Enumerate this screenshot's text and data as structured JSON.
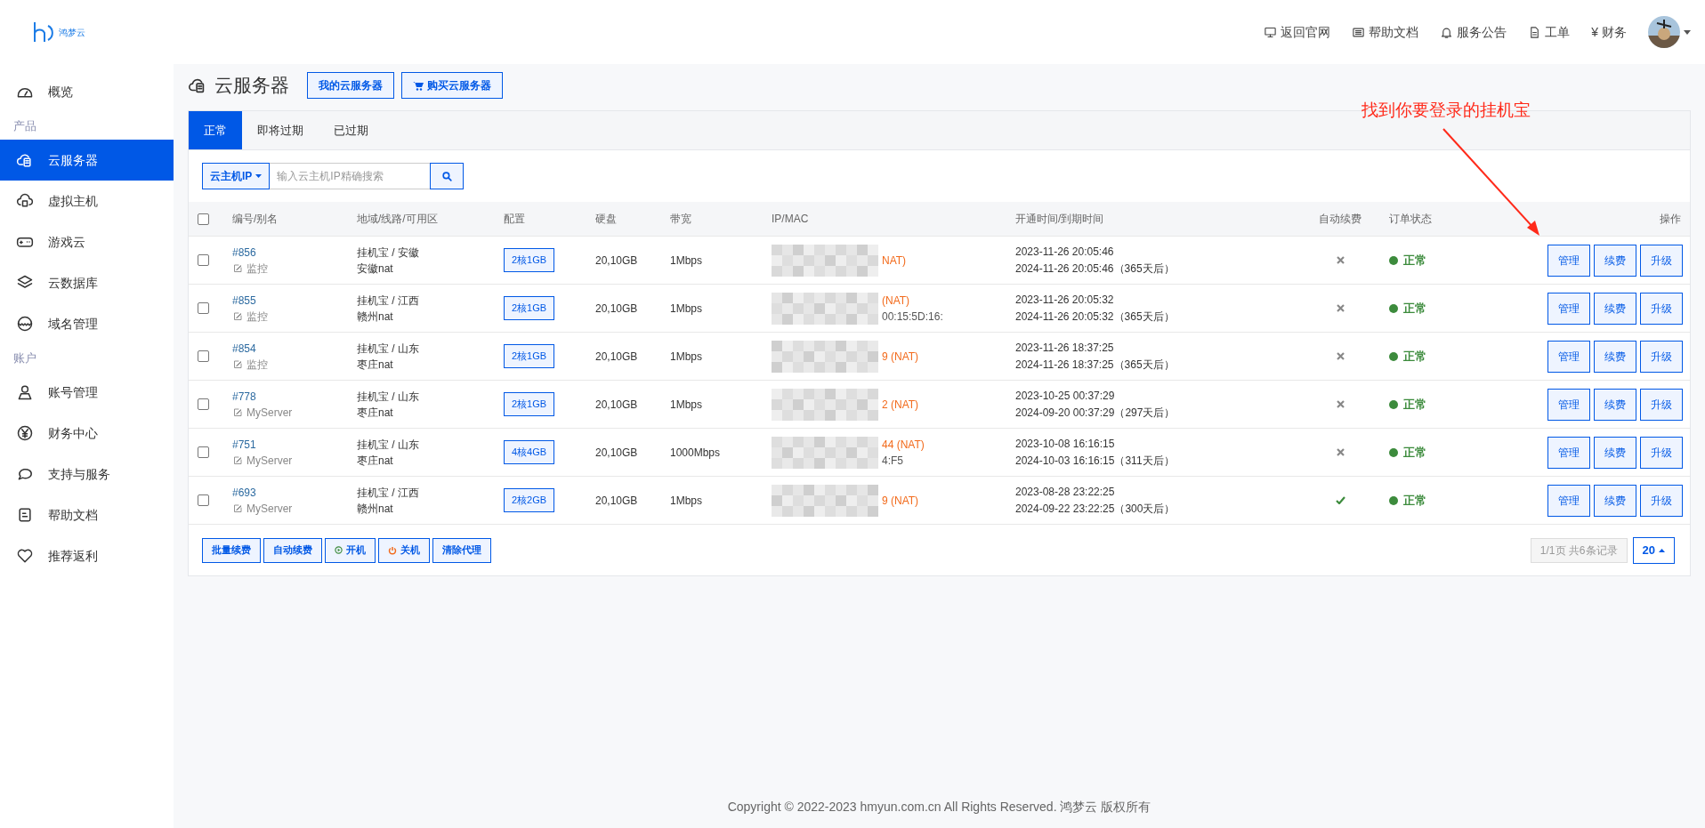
{
  "header": {
    "logo_text": "鸿梦云",
    "nav": [
      {
        "label": "返回官网"
      },
      {
        "label": "帮助文档"
      },
      {
        "label": "服务公告"
      },
      {
        "label": "工单"
      },
      {
        "label": "财务",
        "glyph": "¥"
      }
    ]
  },
  "sidebar": {
    "items": [
      {
        "kind": "item",
        "label": "概览",
        "selected": false
      },
      {
        "kind": "section",
        "label": "产品"
      },
      {
        "kind": "item",
        "label": "云服务器",
        "selected": true
      },
      {
        "kind": "item",
        "label": "虚拟主机",
        "selected": false
      },
      {
        "kind": "item",
        "label": "游戏云",
        "selected": false
      },
      {
        "kind": "item",
        "label": "云数据库",
        "selected": false
      },
      {
        "kind": "item",
        "label": "域名管理",
        "selected": false
      },
      {
        "kind": "section",
        "label": "账户"
      },
      {
        "kind": "item",
        "label": "账号管理",
        "selected": false
      },
      {
        "kind": "item",
        "label": "财务中心",
        "selected": false
      },
      {
        "kind": "item",
        "label": "支持与服务",
        "selected": false
      },
      {
        "kind": "item",
        "label": "帮助文档",
        "selected": false
      },
      {
        "kind": "item",
        "label": "推荐返利",
        "selected": false
      }
    ]
  },
  "page": {
    "title": "云服务器",
    "buttons": [
      {
        "label": "我的云服务器",
        "kind": "plain"
      },
      {
        "label": "购买云服务器",
        "kind": "cart"
      }
    ]
  },
  "tabs": [
    {
      "label": "正常",
      "selected": true
    },
    {
      "label": "即将过期",
      "selected": false
    },
    {
      "label": "已过期",
      "selected": false
    }
  ],
  "search": {
    "filter": "云主机IP",
    "placeholder": "输入云主机IP精确搜索"
  },
  "table": {
    "select_all_checked": false,
    "columns": [
      "编号/别名",
      "地域/线路/可用区",
      "配置",
      "硬盘",
      "带宽",
      "IP/MAC",
      "开通时间/到期时间",
      "自动续费",
      "订单状态",
      "操作"
    ],
    "rows": [
      {
        "checked": false,
        "id": "#856",
        "alias": "监控",
        "region": "挂机宝 / 安徽",
        "line": "安徽nat",
        "config": "2核1GB",
        "disk": "20,10GB",
        "bandwidth": "1Mbps",
        "ip_tail": "NAT)",
        "mac_tail": "",
        "open": "2023-11-26 20:05:46",
        "expire": "2024-11-26 20:05:46",
        "remaining": "（365天后）",
        "auto_renew": false,
        "status": "正常",
        "color": "#3c8b3c",
        "actions": [
          "管理",
          "续费",
          "升级"
        ]
      },
      {
        "checked": false,
        "id": "#855",
        "alias": "监控",
        "region": "挂机宝 / 江西",
        "line": "赣州nat",
        "config": "2核1GB",
        "disk": "20,10GB",
        "bandwidth": "1Mbps",
        "ip_tail": "(NAT)",
        "mac_tail": "00:15:5D:16:",
        "open": "2023-11-26 20:05:32",
        "expire": "2024-11-26 20:05:32",
        "remaining": "（365天后）",
        "auto_renew": false,
        "status": "正常",
        "color": "#3c8b3c",
        "actions": [
          "管理",
          "续费",
          "升级"
        ]
      },
      {
        "checked": false,
        "id": "#854",
        "alias": "监控",
        "region": "挂机宝 / 山东",
        "line": "枣庄nat",
        "config": "2核1GB",
        "disk": "20,10GB",
        "bandwidth": "1Mbps",
        "ip_tail": "9 (NAT)",
        "mac_tail": "",
        "open": "2023-11-26 18:37:25",
        "expire": "2024-11-26 18:37:25",
        "remaining": "（365天后）",
        "auto_renew": false,
        "status": "正常",
        "color": "#3c8b3c",
        "actions": [
          "管理",
          "续费",
          "升级"
        ]
      },
      {
        "checked": false,
        "id": "#778",
        "alias": "MyServer",
        "region": "挂机宝 / 山东",
        "line": "枣庄nat",
        "config": "2核1GB",
        "disk": "20,10GB",
        "bandwidth": "1Mbps",
        "ip_tail": "2 (NAT)",
        "mac_tail": "",
        "open": "2023-10-25 00:37:29",
        "expire": "2024-09-20 00:37:29",
        "remaining": "（297天后）",
        "auto_renew": false,
        "status": "正常",
        "color": "#3c8b3c",
        "actions": [
          "管理",
          "续费",
          "升级"
        ]
      },
      {
        "checked": false,
        "id": "#751",
        "alias": "MyServer",
        "region": "挂机宝 / 山东",
        "line": "枣庄nat",
        "config": "4核4GB",
        "disk": "20,10GB",
        "bandwidth": "1000Mbps",
        "ip_tail": "44 (NAT)",
        "mac_tail": "4:F5",
        "open": "2023-10-08 16:16:15",
        "expire": "2024-10-03 16:16:15",
        "remaining": "（311天后）",
        "auto_renew": false,
        "status": "正常",
        "color": "#3c8b3c",
        "actions": [
          "管理",
          "续费",
          "升级"
        ]
      },
      {
        "checked": false,
        "id": "#693",
        "alias": "MyServer",
        "region": "挂机宝 / 江西",
        "line": "赣州nat",
        "config": "2核2GB",
        "disk": "20,10GB",
        "bandwidth": "1Mbps",
        "ip_tail": "9 (NAT)",
        "mac_tail": "",
        "open": "2023-08-28 23:22:25",
        "expire": "2024-09-22 23:22:25",
        "remaining": "（300天后）",
        "auto_renew": true,
        "status": "正常",
        "color": "#3c8b3c",
        "actions": [
          "管理",
          "续费",
          "升级"
        ]
      }
    ]
  },
  "bulk_actions": [
    {
      "label": "批量续费",
      "kind": "plain"
    },
    {
      "label": "自动续费",
      "kind": "plain"
    },
    {
      "label": "开机",
      "kind": "power_on"
    },
    {
      "label": "关机",
      "kind": "power_off"
    },
    {
      "label": "清除代理",
      "kind": "plain"
    }
  ],
  "pagination": {
    "summary": "1/1页 共6条记录",
    "page_size": "20"
  },
  "annotation": {
    "text": "找到你要登录的挂机宝"
  },
  "footer": {
    "copyright": "Copyright © 2022-2023 hmyun.com.cn All Rights Reserved. 鸿梦云 版权所有"
  }
}
